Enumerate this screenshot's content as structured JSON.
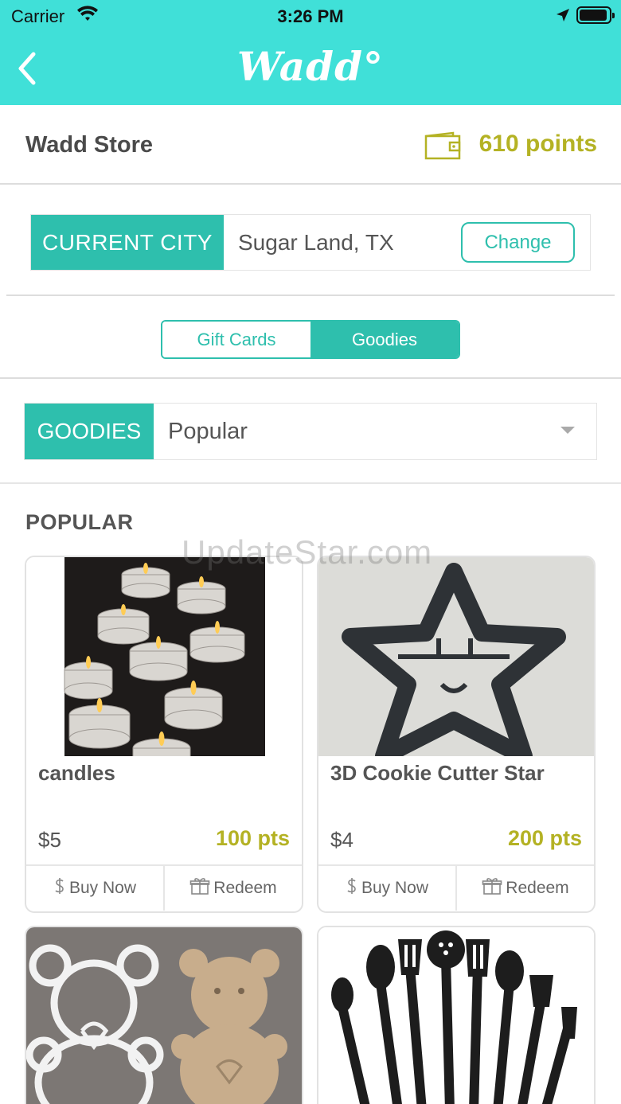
{
  "status_bar": {
    "carrier": "Carrier",
    "time": "3:26 PM"
  },
  "nav": {
    "logo": "Wadd°"
  },
  "store": {
    "title": "Wadd Store",
    "points": "610 points"
  },
  "city": {
    "label": "CURRENT CITY",
    "value": "Sugar Land, TX",
    "change_label": "Change"
  },
  "segments": [
    {
      "label": "Gift Cards",
      "active": false
    },
    {
      "label": "Goodies",
      "active": true
    }
  ],
  "filter": {
    "label": "GOODIES",
    "selected": "Popular"
  },
  "section": {
    "title": "POPULAR"
  },
  "watermark": "UpdateStar.com",
  "products": [
    {
      "name": "candles",
      "price": "$5",
      "points": "100 pts",
      "buy_label": "Buy Now",
      "redeem_label": "Redeem",
      "image": "candles-photo"
    },
    {
      "name": "3D Cookie Cutter Star",
      "price": "$4",
      "points": "200 pts",
      "buy_label": "Buy Now",
      "redeem_label": "Redeem",
      "image": "star-cookie-cutter-photo"
    },
    {
      "image": "teddy-bear-cookie-cutter-photo"
    },
    {
      "image": "kitchen-utensils-photo"
    }
  ],
  "colors": {
    "nav_bg": "#40e0d8",
    "accent": "#2ebfad",
    "points": "#b4b224"
  }
}
